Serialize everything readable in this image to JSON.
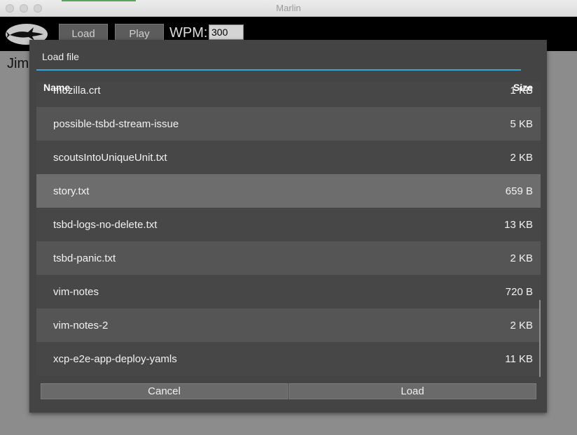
{
  "window": {
    "title": "Marlin"
  },
  "toolbar": {
    "load_label": "Load",
    "play_label": "Play",
    "wpm_label": "WPM:",
    "wpm_value": "300"
  },
  "content": {
    "text": "Jim"
  },
  "dialog": {
    "title": "Load file",
    "columns": {
      "name": "Name",
      "size": "Size"
    },
    "files": [
      {
        "name": "mozilla.crt",
        "size": "1 KB"
      },
      {
        "name": "possible-tsbd-stream-issue",
        "size": "5 KB"
      },
      {
        "name": "scoutsIntoUniqueUnit.txt",
        "size": "2 KB"
      },
      {
        "name": "story.txt",
        "size": "659 B",
        "selected": true
      },
      {
        "name": "tsbd-logs-no-delete.txt",
        "size": "13 KB"
      },
      {
        "name": "tsbd-panic.txt",
        "size": "2 KB"
      },
      {
        "name": "vim-notes",
        "size": "720 B"
      },
      {
        "name": "vim-notes-2",
        "size": "2 KB"
      },
      {
        "name": "xcp-e2e-app-deploy-yamls",
        "size": "11 KB"
      }
    ],
    "cancel_label": "Cancel",
    "load_label": "Load"
  },
  "colors": {
    "accent": "#38a9d7",
    "dialog_bg": "#444444",
    "selected_row": "#6d6d6d"
  },
  "icons": {
    "logo": "marlin-fish-logo"
  }
}
